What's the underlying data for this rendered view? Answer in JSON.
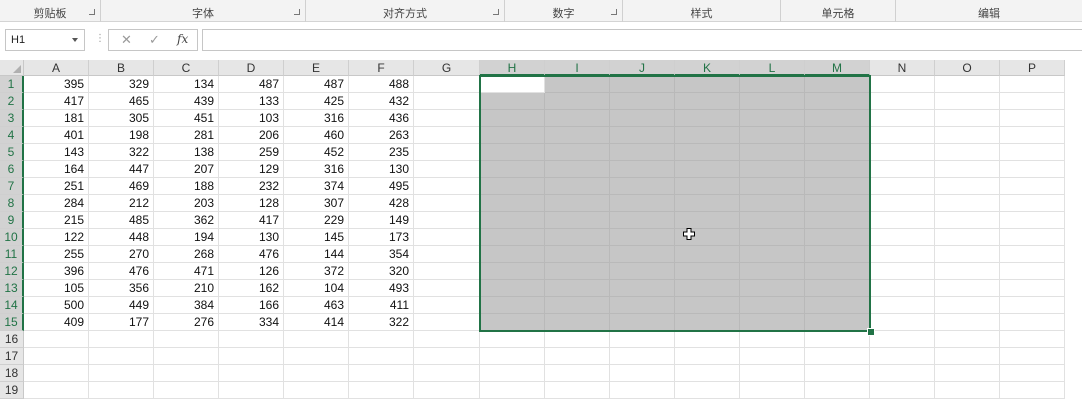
{
  "ribbon": {
    "groups": [
      {
        "label": "剪贴板",
        "launcher": true
      },
      {
        "label": "字体",
        "launcher": true
      },
      {
        "label": "对齐方式",
        "launcher": true
      },
      {
        "label": "数字",
        "launcher": true
      },
      {
        "label": "样式",
        "launcher": false
      },
      {
        "label": "单元格",
        "launcher": false
      },
      {
        "label": "编辑",
        "launcher": false
      }
    ]
  },
  "formula_bar": {
    "name_box": "H1",
    "cancel_icon": "✕",
    "enter_icon": "✓",
    "fx_label": "fx",
    "formula": ""
  },
  "sheet": {
    "columns": [
      "A",
      "B",
      "C",
      "D",
      "E",
      "F",
      "G",
      "H",
      "I",
      "J",
      "K",
      "L",
      "M",
      "N",
      "O",
      "P"
    ],
    "rows": [
      "1",
      "2",
      "3",
      "4",
      "5",
      "6",
      "7",
      "8",
      "9",
      "10",
      "11",
      "12",
      "13",
      "14",
      "15",
      "16",
      "17",
      "18",
      "19"
    ],
    "selection": {
      "range": "H1:M15",
      "active_cell": "H1",
      "selected_columns": [
        "H",
        "I",
        "J",
        "K",
        "L",
        "M"
      ]
    },
    "data": [
      [
        "395",
        "329",
        "134",
        "487",
        "487",
        "488"
      ],
      [
        "417",
        "465",
        "439",
        "133",
        "425",
        "432"
      ],
      [
        "181",
        "305",
        "451",
        "103",
        "316",
        "436"
      ],
      [
        "401",
        "198",
        "281",
        "206",
        "460",
        "263"
      ],
      [
        "143",
        "322",
        "138",
        "259",
        "452",
        "235"
      ],
      [
        "164",
        "447",
        "207",
        "129",
        "316",
        "130"
      ],
      [
        "251",
        "469",
        "188",
        "232",
        "374",
        "495"
      ],
      [
        "284",
        "212",
        "203",
        "128",
        "307",
        "428"
      ],
      [
        "215",
        "485",
        "362",
        "417",
        "229",
        "149"
      ],
      [
        "122",
        "448",
        "194",
        "130",
        "145",
        "173"
      ],
      [
        "255",
        "270",
        "268",
        "476",
        "144",
        "354"
      ],
      [
        "396",
        "476",
        "471",
        "126",
        "372",
        "320"
      ],
      [
        "105",
        "356",
        "210",
        "162",
        "104",
        "493"
      ],
      [
        "500",
        "449",
        "384",
        "166",
        "463",
        "411"
      ],
      [
        "409",
        "177",
        "276",
        "334",
        "414",
        "322"
      ]
    ]
  },
  "colors": {
    "selection_border": "#217346",
    "selection_fill": "#c6c6c6",
    "header_bg": "#e6e6e6"
  }
}
